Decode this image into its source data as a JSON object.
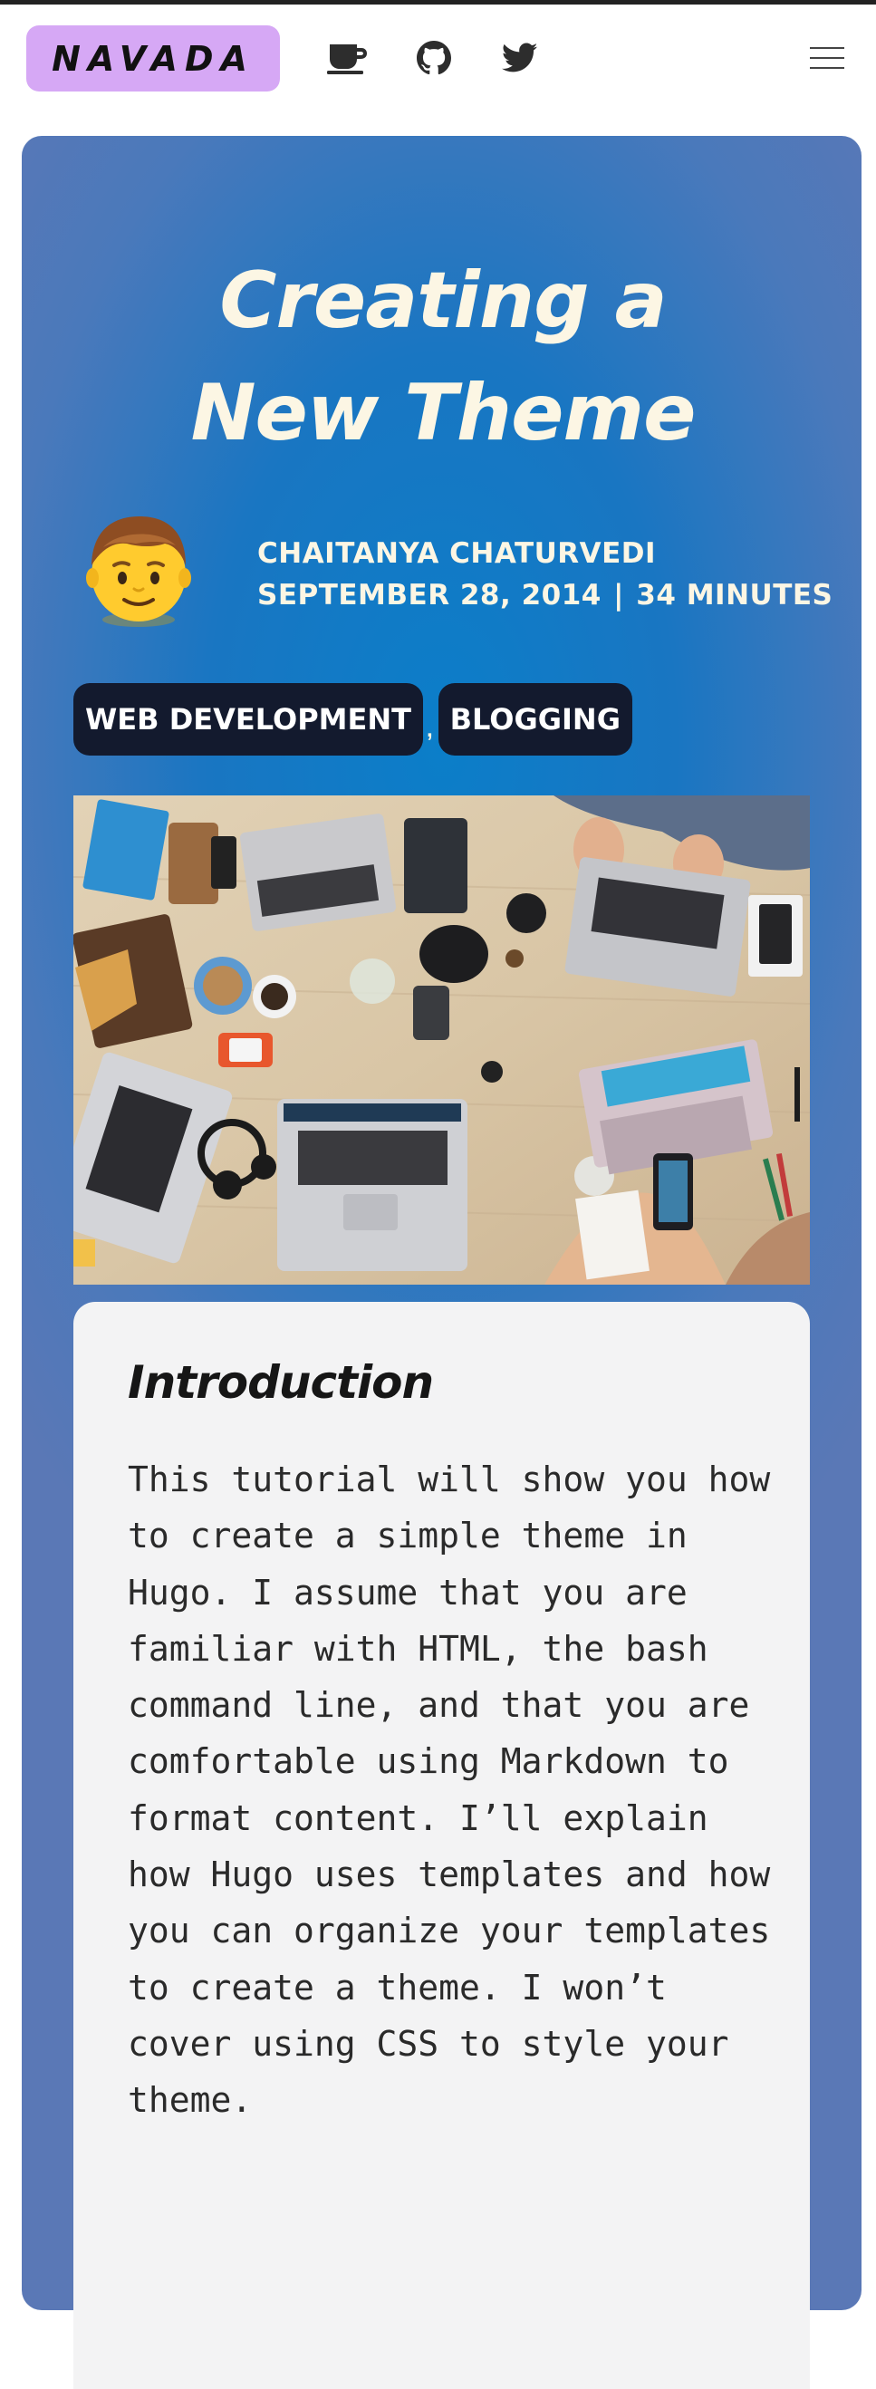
{
  "header": {
    "logo_text": "NAVADA",
    "icons": [
      "coffee-icon",
      "github-icon",
      "twitter-icon",
      "hamburger-menu-icon"
    ]
  },
  "post": {
    "title": "Creating a New Theme",
    "avatar": "👨",
    "author": "CHAITANYA CHATURVEDI",
    "date": "SEPTEMBER 28, 2014",
    "separator": "|",
    "read_time": "34 MINUTES",
    "tags": [
      "WEB DEVELOPMENT",
      "BLOGGING"
    ],
    "tag_separator": ","
  },
  "content": {
    "heading": "Introduction",
    "paragraph": "This tutorial will show you how to create a simple theme in Hugo. I assume that you are familiar with HTML, the bash command line, and that you are comfortable using Markdown to format content. I’ll explain how Hugo uses templates and how you can organize your templates to create a theme. I won’t cover using CSS to style your theme."
  },
  "colors": {
    "logo_bg": "#d6a8f5",
    "card_center": "#0b7ec9",
    "card_edge": "#5a78b6",
    "title_text": "#fcf6e4",
    "tag_bg": "#131a2e",
    "content_bg": "#f3f3f4"
  }
}
